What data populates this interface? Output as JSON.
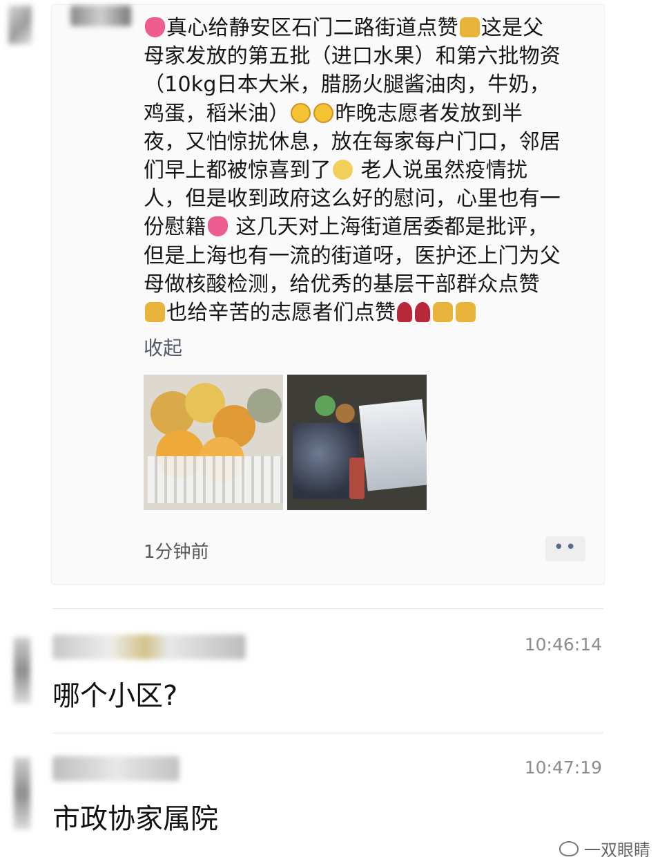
{
  "post": {
    "text_lines": [
      [
        "heart-icon",
        "真心给静安区石门二路街道点赞",
        "thumb-icon",
        "这是父"
      ],
      [
        "母家发放的第五批（进口水果）和第六批物资"
      ],
      [
        "（10kg日本大米，腊肠火腿酱油肉，牛奶，"
      ],
      [
        "鸡蛋，稻米油）",
        "smile-icon",
        "smile-icon",
        "昨晚志愿者发放到半"
      ],
      [
        "夜，又怕惊扰休息，放在每家每户门口，邻居"
      ],
      [
        "们早上都被惊喜到了",
        "grin-icon",
        " 老人说虽然疫情扰"
      ],
      [
        "人，但是收到政府这么好的慰问，心里也有一"
      ],
      [
        "份慰籍",
        "heart-icon",
        " 这几天对上海街道居委都是批评，"
      ],
      [
        "但是上海也有一流的街道呀，医护还上门为父"
      ],
      [
        "母做核酸检测，给优秀的基层干部群众点赞"
      ],
      [
        "thumb-icon",
        "也给辛苦的志愿者们点赞",
        "rose-icon",
        "rose-icon",
        "thumb-icon",
        "thumb-icon"
      ]
    ],
    "collapse_label": "收起",
    "time_ago": "1分钟前",
    "more_label": "••"
  },
  "comments": [
    {
      "time": "10:46:14",
      "text": "哪个小区?"
    },
    {
      "time": "10:47:19",
      "text": "市政协家属院"
    }
  ],
  "watermark": {
    "text": "一双眼睛",
    "icon": "wechat-icon"
  }
}
